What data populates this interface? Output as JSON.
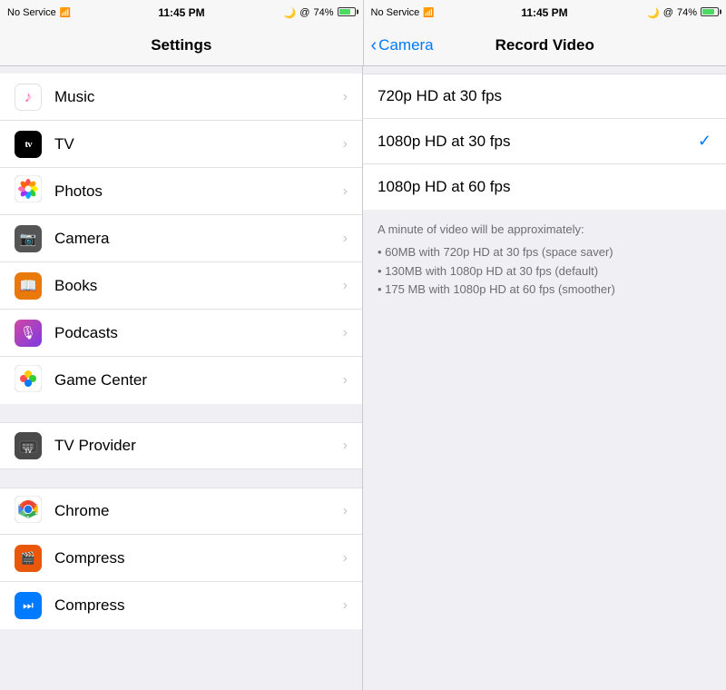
{
  "statusBar": {
    "left": {
      "signal": "No Service",
      "wifi": "📶",
      "time": "11:45 PM",
      "moon": "🌙",
      "at": "@",
      "battery": "74%"
    },
    "right": {
      "signal": "No Service",
      "wifi": "📶",
      "time": "11:45 PM",
      "moon": "🌙",
      "at": "@",
      "battery": "74%"
    }
  },
  "leftNav": {
    "title": "Settings"
  },
  "rightNav": {
    "backLabel": "Camera",
    "title": "Record Video"
  },
  "settingsRows": [
    {
      "id": "music",
      "label": "Music",
      "icon": "music"
    },
    {
      "id": "tv",
      "label": "TV",
      "icon": "tv"
    },
    {
      "id": "photos",
      "label": "Photos",
      "icon": "photos"
    },
    {
      "id": "camera",
      "label": "Camera",
      "icon": "camera"
    },
    {
      "id": "books",
      "label": "Books",
      "icon": "books"
    },
    {
      "id": "podcasts",
      "label": "Podcasts",
      "icon": "podcasts"
    },
    {
      "id": "gamecenter",
      "label": "Game Center",
      "icon": "gamecenter"
    }
  ],
  "settingsRows2": [
    {
      "id": "tvprovider",
      "label": "TV Provider",
      "icon": "tvprovider"
    }
  ],
  "settingsRows3": [
    {
      "id": "chrome",
      "label": "Chrome",
      "icon": "chrome"
    },
    {
      "id": "compress1",
      "label": "Compress",
      "icon": "compress1"
    },
    {
      "id": "compress2",
      "label": "Compress",
      "icon": "compress2"
    }
  ],
  "videoOptions": [
    {
      "id": "720p30",
      "label": "720p HD at 30 fps",
      "selected": false
    },
    {
      "id": "1080p30",
      "label": "1080p HD at 30 fps",
      "selected": true
    },
    {
      "id": "1080p60",
      "label": "1080p HD at 60 fps",
      "selected": false
    }
  ],
  "infoText": {
    "heading": "A minute of video will be approximately:",
    "bullets": [
      "60MB with 720p HD at 30 fps (space saver)",
      "130MB with 1080p HD at 30 fps (default)",
      "175 MB with 1080p HD at 60 fps (smoother)"
    ]
  }
}
